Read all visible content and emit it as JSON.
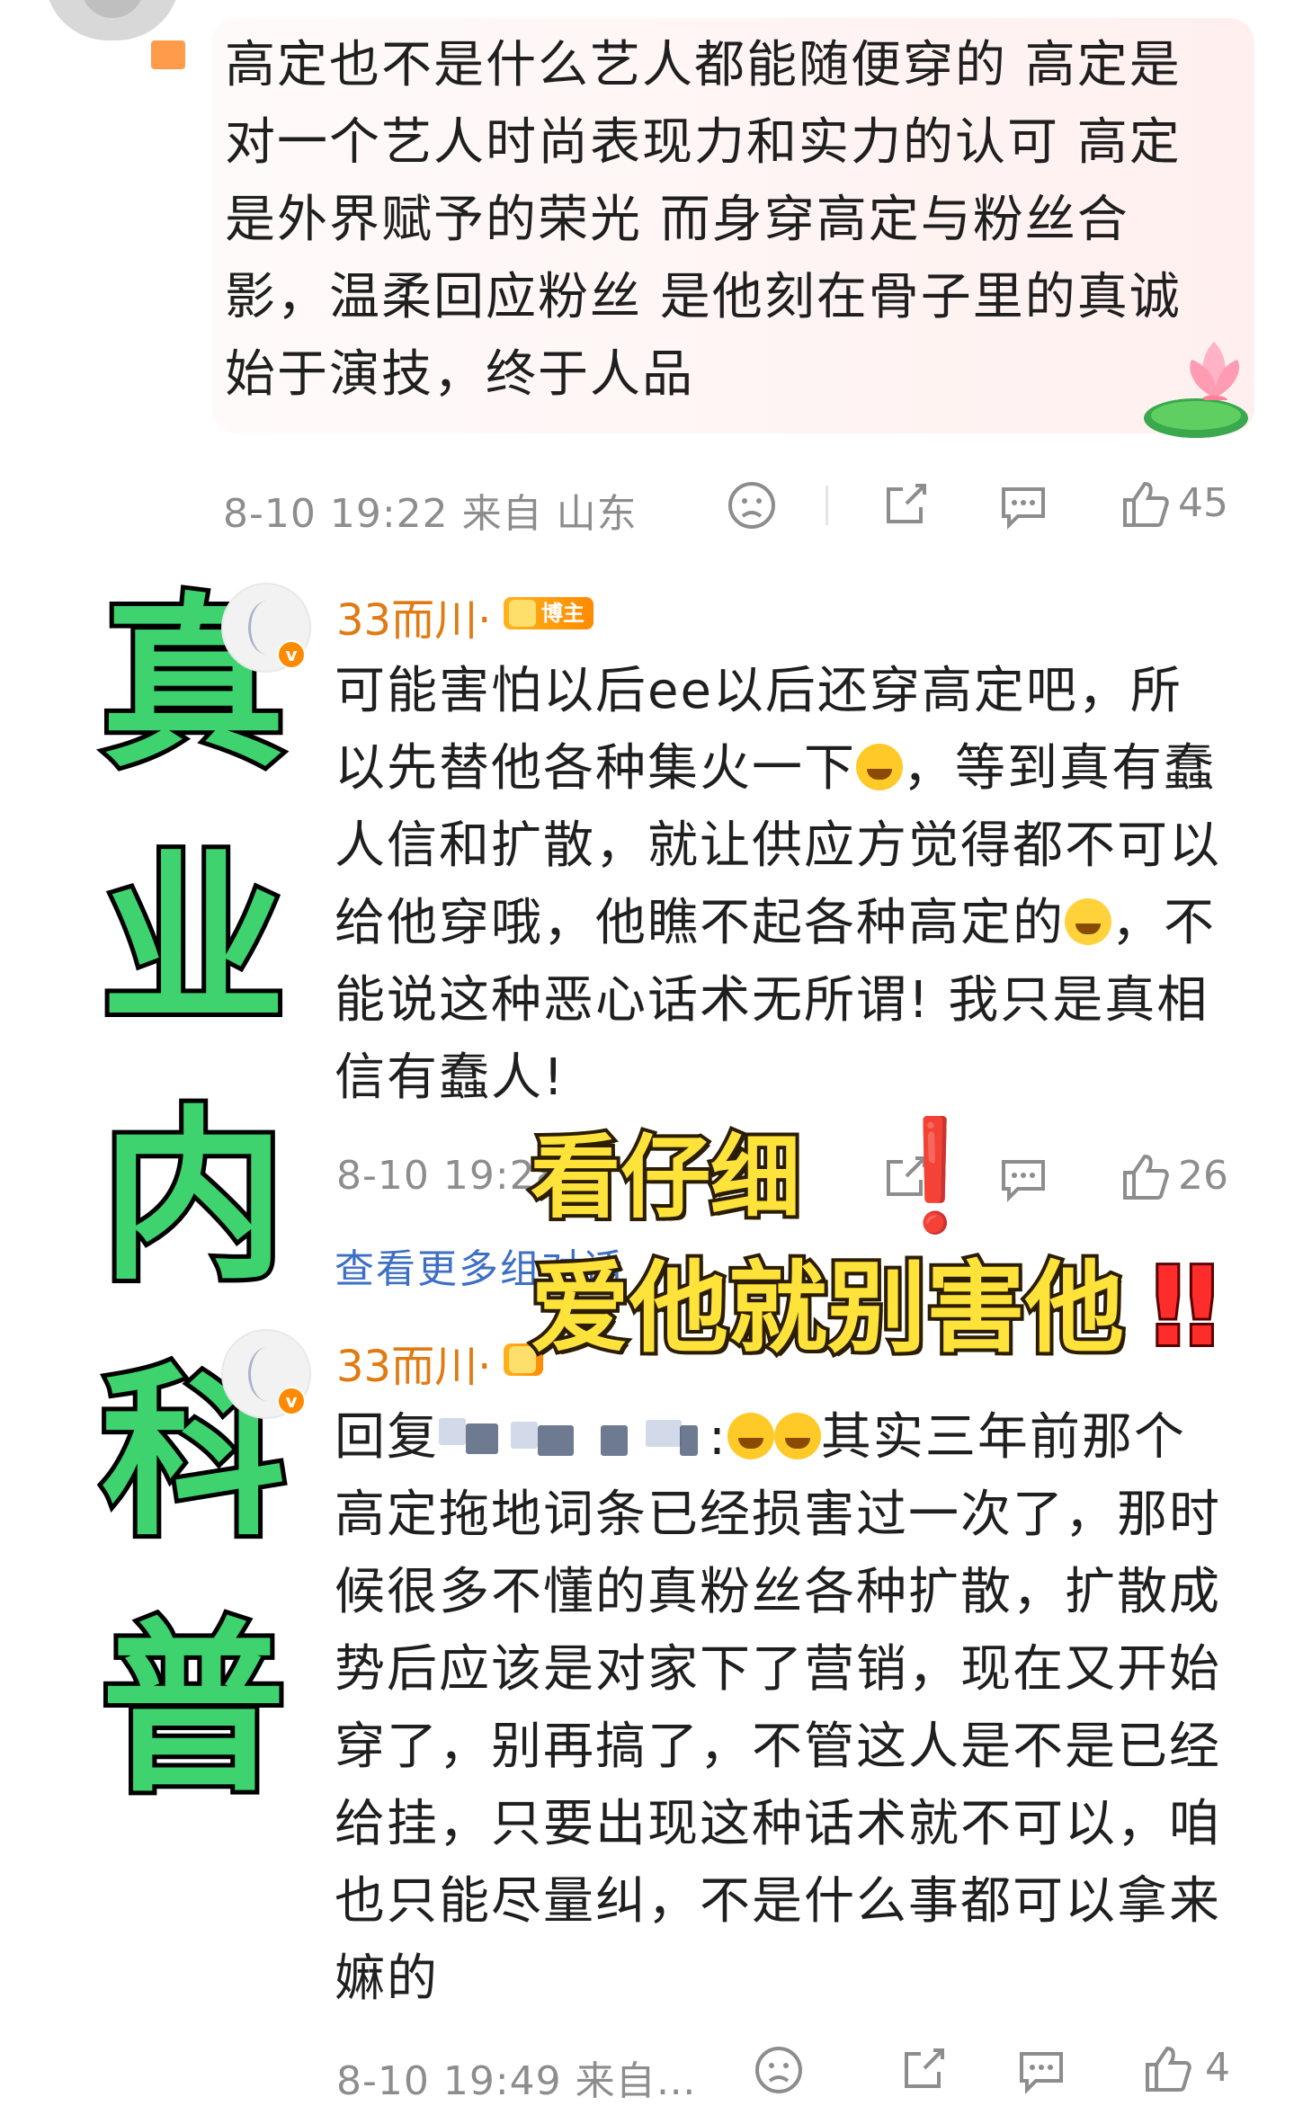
{
  "comment_top": {
    "text": "高定也不是什么艺人都能随便穿的 高定是对一个艺人时尚表现力和实力的认可 高定是外界赋予的荣光 而身穿高定与粉丝合影，温柔回应粉丝 是他刻在骨子里的真诚始于演技，终于人品",
    "meta": "8-10 19:22 来自 山东",
    "like_count": "45"
  },
  "side_title": [
    "真",
    "业",
    "内",
    "科",
    "普"
  ],
  "reply1": {
    "username": "33而川·",
    "badge": "博主",
    "text_part1": "可能害怕以后ee以后还穿高定吧，所以先替他各种集火一下",
    "text_part2": "，等到真有蠢人信和扩散，就让供应方觉得都不可以给他穿哦，他瞧不起各种高定的",
    "text_part3": "，不能说这种恶心话术无所谓! 我只是真相信有蠢人!",
    "meta": "8-10 19:28",
    "like_count": "26"
  },
  "more_replies": "查看更多组对话",
  "overlay": {
    "line1": "看仔细",
    "line1_mark": "❗",
    "line2": "爱他就别害他",
    "line2_mark": "‼"
  },
  "reply2": {
    "username": "33而川·",
    "reply_prefix": "回复",
    "reply_colon": ":",
    "text": "其实三年前那个高定拖地词条已经损害过一次了，那时候很多不懂的真粉丝各种扩散，扩散成势后应该是对家下了营销，现在又开始穿了，别再搞了，不管这人是不是已经给挂，只要出现这种话术就不可以，咱也只能尽量纠，不是什么事都可以拿来嫲的",
    "meta": "8-10 19:49 来自…",
    "like_count": "4"
  },
  "colors": {
    "accent_green": "#3ed36f",
    "username_orange": "#e07a12",
    "link_blue": "#3d6fc4",
    "overlay_yellow": "#ffe23a",
    "alert_red": "#ff2c2c"
  },
  "icons": [
    "sad-face-icon",
    "share-icon",
    "comment-icon",
    "thumbs-up-icon",
    "lotus-icon",
    "verified-icon",
    "crown-icon",
    "laughing-emoji-icon",
    "crying-emoji-icon"
  ]
}
